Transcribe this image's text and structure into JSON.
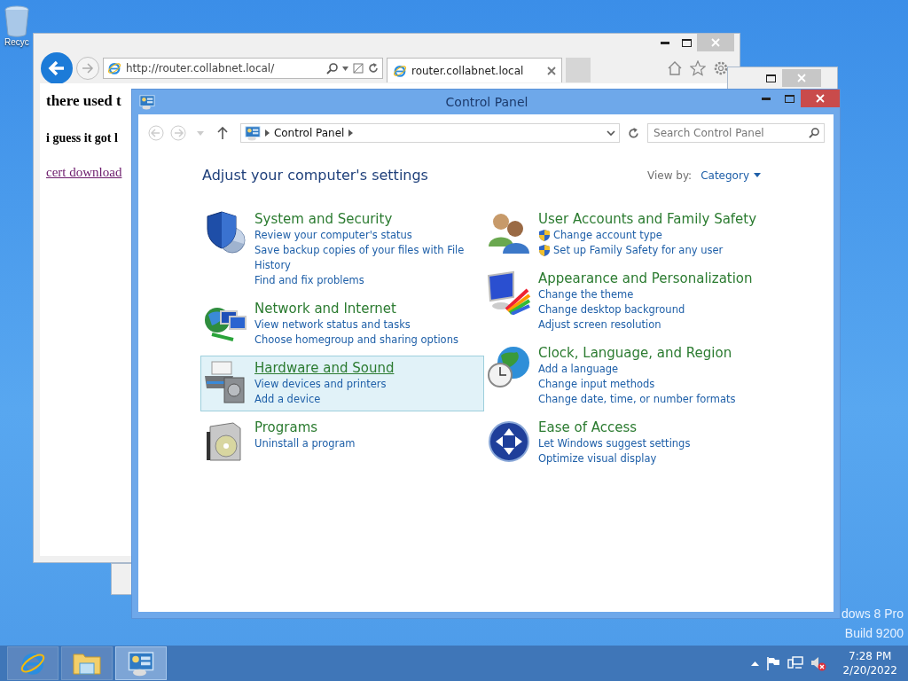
{
  "desktop": {
    "icons": [
      {
        "label": "Recyc"
      }
    ],
    "edition_text": [
      "dows 8 Pro",
      "Build 9200"
    ]
  },
  "browser": {
    "address": "http://router.collabnet.local/",
    "tabs": [
      {
        "label": "router.collabnet.local",
        "selected": true
      }
    ],
    "page": {
      "heading": "there used t",
      "subheading": "i guess it got l",
      "link": "cert download"
    }
  },
  "control_panel": {
    "title": "Control Panel",
    "breadcrumb": [
      "Control Panel"
    ],
    "search": {
      "placeholder": "Search Control Panel"
    },
    "heading": "Adjust your computer's settings",
    "view_by": {
      "label": "View by:",
      "value": "Category"
    },
    "left_column": [
      {
        "kind": "security",
        "title": "System and Security",
        "hovered": false,
        "links": [
          {
            "label": "Review your computer's status",
            "shield": false
          },
          {
            "label": "Save backup copies of your files with File History",
            "shield": false
          },
          {
            "label": "Find and fix problems",
            "shield": false
          }
        ]
      },
      {
        "kind": "network",
        "title": "Network and Internet",
        "hovered": false,
        "links": [
          {
            "label": "View network status and tasks",
            "shield": false
          },
          {
            "label": "Choose homegroup and sharing options",
            "shield": false
          }
        ]
      },
      {
        "kind": "hardware",
        "title": "Hardware and Sound",
        "hovered": true,
        "links": [
          {
            "label": "View devices and printers",
            "shield": false
          },
          {
            "label": "Add a device",
            "shield": false
          }
        ]
      },
      {
        "kind": "programs",
        "title": "Programs",
        "hovered": false,
        "links": [
          {
            "label": "Uninstall a program",
            "shield": false
          }
        ]
      }
    ],
    "right_column": [
      {
        "kind": "users",
        "title": "User Accounts and Family Safety",
        "hovered": false,
        "links": [
          {
            "label": "Change account type",
            "shield": true
          },
          {
            "label": "Set up Family Safety for any user",
            "shield": true
          }
        ]
      },
      {
        "kind": "appearance",
        "title": "Appearance and Personalization",
        "hovered": false,
        "links": [
          {
            "label": "Change the theme",
            "shield": false
          },
          {
            "label": "Change desktop background",
            "shield": false
          },
          {
            "label": "Adjust screen resolution",
            "shield": false
          }
        ]
      },
      {
        "kind": "clock",
        "title": "Clock, Language, and Region",
        "hovered": false,
        "links": [
          {
            "label": "Add a language",
            "shield": false
          },
          {
            "label": "Change input methods",
            "shield": false
          },
          {
            "label": "Change date, time, or number formats",
            "shield": false
          }
        ]
      },
      {
        "kind": "access",
        "title": "Ease of Access",
        "hovered": false,
        "links": [
          {
            "label": "Let Windows suggest settings",
            "shield": false
          },
          {
            "label": "Optimize visual display",
            "shield": false
          }
        ]
      }
    ]
  },
  "taskbar": {
    "buttons": [
      {
        "kind": "ie",
        "selected": false
      },
      {
        "kind": "explorer",
        "selected": false
      },
      {
        "kind": "control-panel",
        "selected": true
      }
    ],
    "clock": {
      "time": "7:28 PM",
      "date": "2/20/2022"
    }
  }
}
